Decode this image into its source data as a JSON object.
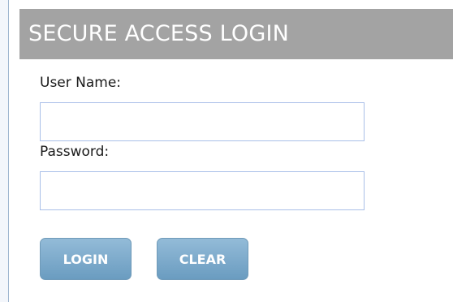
{
  "header": {
    "title": "SECURE ACCESS LOGIN"
  },
  "form": {
    "username_label": "User Name:",
    "username_value": "",
    "password_label": "Password:",
    "password_value": "",
    "login_label": "LOGIN",
    "clear_label": "CLEAR"
  },
  "colors": {
    "header_bg": "#a3a3a3",
    "button_bg": "#7aa8c9",
    "input_border": "#a9bfe8"
  }
}
